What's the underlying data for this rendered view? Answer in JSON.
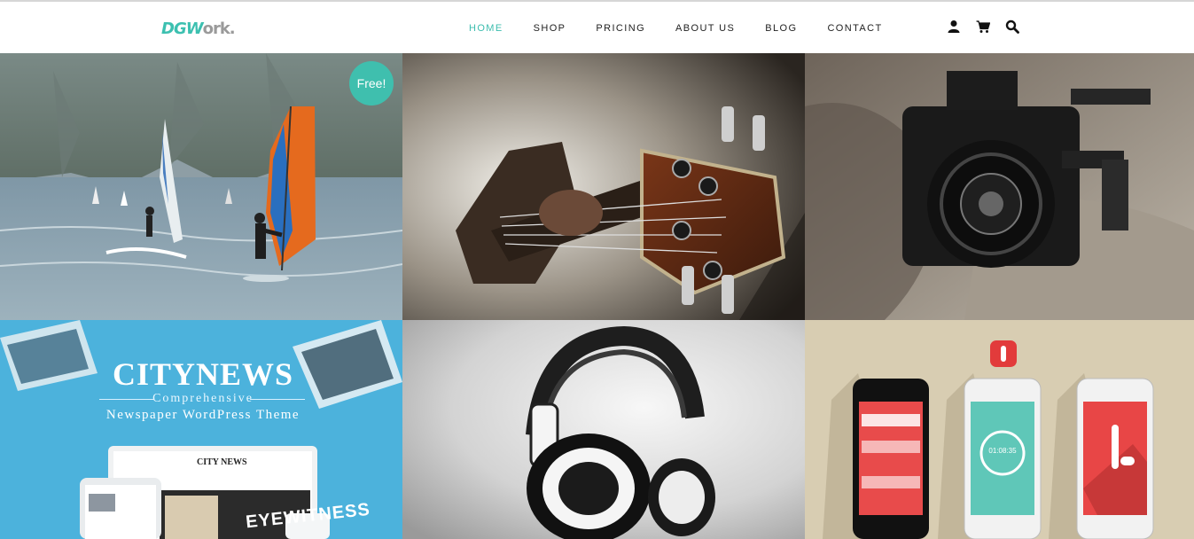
{
  "brand": {
    "logo_part_a": "DGW",
    "logo_part_b": "ork."
  },
  "nav": {
    "items": [
      {
        "label": "HOME",
        "active": true
      },
      {
        "label": "SHOP",
        "active": false
      },
      {
        "label": "PRICING",
        "active": false
      },
      {
        "label": "ABOUT US",
        "active": false
      },
      {
        "label": "BLOG",
        "active": false
      },
      {
        "label": "CONTACT",
        "active": false
      }
    ]
  },
  "toolbar": {
    "icons": [
      "user-icon",
      "cart-icon",
      "search-icon"
    ]
  },
  "colors": {
    "accent": "#3cbdae",
    "text": "#222222",
    "citynews_bg": "#4cb2dc",
    "app_bg": "#d8cdb2"
  },
  "portfolio": {
    "badge": "Free!",
    "tiles": [
      {
        "subject": "windsurfing"
      },
      {
        "subject": "bass-guitar"
      },
      {
        "subject": "video-camera"
      },
      {
        "subject": "citynews-theme",
        "title": "CITYNEWS",
        "subtitle": "Comprehensive",
        "tagline": "Newspaper WordPress Theme",
        "mock_header": "CITY NEWS",
        "mock_banner": "EYEWITNESS"
      },
      {
        "subject": "headphones"
      },
      {
        "subject": "mobile-app",
        "clock": "01:08:35"
      }
    ]
  }
}
